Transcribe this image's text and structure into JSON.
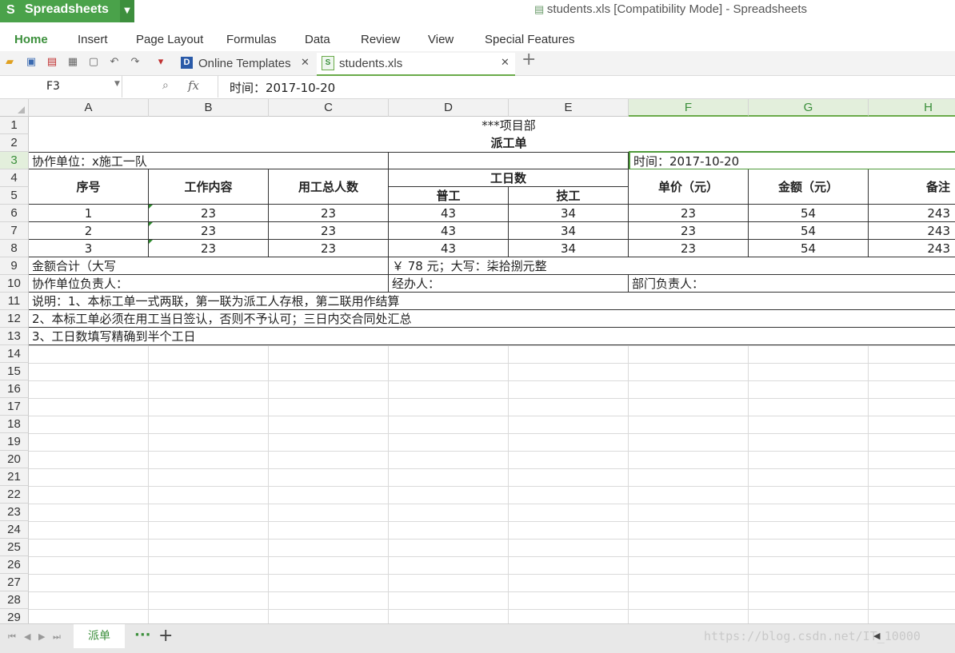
{
  "app": {
    "name": "Spreadsheets",
    "logo": "S"
  },
  "window": {
    "title": "students.xls [Compatibility Mode] - Spreadsheets"
  },
  "menu": [
    "Home",
    "Insert",
    "Page Layout",
    "Formulas",
    "Data",
    "Review",
    "View",
    "Special Features"
  ],
  "menu_active": "Home",
  "tabs": [
    {
      "label": "Online Templates",
      "icon": "online-templates-icon"
    },
    {
      "label": "students.xls",
      "icon": "xls-file-icon"
    }
  ],
  "formula": {
    "cell_ref": "F3",
    "fx": "fx",
    "value": "时间：2017-10-20"
  },
  "columns": [
    "A",
    "B",
    "C",
    "D",
    "E",
    "F",
    "G",
    "H"
  ],
  "rows": [
    "1",
    "2",
    "3",
    "4",
    "5",
    "6",
    "7",
    "8",
    "9",
    "10",
    "11",
    "12",
    "13",
    "14",
    "15",
    "16",
    "17",
    "18",
    "19",
    "20",
    "21",
    "22",
    "23",
    "24",
    "25",
    "26",
    "27",
    "28",
    "29"
  ],
  "sheet": {
    "r1": "***项目部",
    "r2": "派工单",
    "r3_a": "协作单位：x施工一队",
    "r3_f": "时间：2017-10-20",
    "headers": {
      "seq": "序号",
      "content": "工作内容",
      "total": "用工总人数",
      "workdays": "工日数",
      "normal": "普工",
      "skilled": "技工",
      "price": "单价（元）",
      "amount": "金额（元）",
      "note": "备注"
    },
    "data_rows": [
      [
        "1",
        "23",
        "23",
        "43",
        "34",
        "23",
        "54",
        "243"
      ],
      [
        "2",
        "23",
        "23",
        "43",
        "34",
        "23",
        "54",
        "243"
      ],
      [
        "3",
        "23",
        "23",
        "43",
        "34",
        "23",
        "54",
        "243"
      ]
    ],
    "r9_a": "金额合计（大写",
    "r9_d": "￥ 78 元；大写：柒拾捌元整",
    "r10_a": "协作单位负责人：",
    "r10_d": "经办人：",
    "r10_f": "部门负责人：",
    "r11": "说明：1、本标工单一式两联，第一联为派工人存根，第二联用作结算",
    "r12": "2、本标工单必须在用工当日签认，否则不予认可；三日内交合同处汇总",
    "r13": "3、工日数填写精确到半个工日"
  },
  "sheet_tab": "派单",
  "status_watermark": "https://blog.csdn.net/IT_10000",
  "colors": {
    "accent": "#4aa24a",
    "selected_header": "#e3efdc"
  }
}
